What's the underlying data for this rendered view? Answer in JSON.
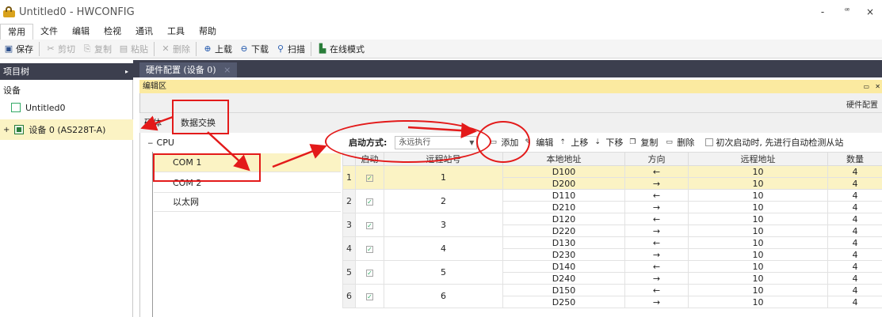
{
  "window": {
    "title": "Untitled0 - HWCONFIG",
    "minimize": "-",
    "restore": "ꟹ",
    "close": "×"
  },
  "menu": [
    "常用",
    "文件",
    "编辑",
    "检视",
    "通讯",
    "工具",
    "帮助"
  ],
  "toolbar": {
    "save": "保存",
    "cut": "剪切",
    "copy": "复制",
    "paste": "粘贴",
    "delete": "删除",
    "upload": "上载",
    "download": "下载",
    "scan": "扫描",
    "online": "在线模式"
  },
  "project_tree": {
    "header": "项目树",
    "pin": "▸",
    "section": "设备",
    "root": "Untitled0",
    "device": "设备 0 (AS228T-A)",
    "expander": "+"
  },
  "doc_tab": {
    "label": "硬件配置 (设备 0)",
    "close": "×"
  },
  "editor": {
    "title": "编辑区",
    "hw_config": "硬件配置"
  },
  "sub_tabs": {
    "tab1": "硬体",
    "tab2": "数据交换"
  },
  "cpu_tree": {
    "title": "CPU",
    "items": [
      "COM 1",
      "COM 2",
      "以太网"
    ]
  },
  "exchange": {
    "start_label": "启动方式:",
    "mode": "永远执行",
    "add": "添加",
    "edit": "编辑",
    "up": "上移",
    "down": "下移",
    "copy": "复制",
    "delete": "删除",
    "auto_detect": "初次启动时, 先进行自动检测从站"
  },
  "table": {
    "headers": [
      "",
      "启动",
      "远程站号",
      "本地地址",
      "方向",
      "远程地址",
      "数量"
    ],
    "rows": [
      {
        "no": "1",
        "station": "1",
        "lines": [
          {
            "local": "D100",
            "dir": "←",
            "remote": "10",
            "qty": "4"
          },
          {
            "local": "D200",
            "dir": "→",
            "remote": "10",
            "qty": "4"
          }
        ]
      },
      {
        "no": "2",
        "station": "2",
        "lines": [
          {
            "local": "D110",
            "dir": "←",
            "remote": "10",
            "qty": "4"
          },
          {
            "local": "D210",
            "dir": "→",
            "remote": "10",
            "qty": "4"
          }
        ]
      },
      {
        "no": "3",
        "station": "3",
        "lines": [
          {
            "local": "D120",
            "dir": "←",
            "remote": "10",
            "qty": "4"
          },
          {
            "local": "D220",
            "dir": "→",
            "remote": "10",
            "qty": "4"
          }
        ]
      },
      {
        "no": "4",
        "station": "4",
        "lines": [
          {
            "local": "D130",
            "dir": "←",
            "remote": "10",
            "qty": "4"
          },
          {
            "local": "D230",
            "dir": "→",
            "remote": "10",
            "qty": "4"
          }
        ]
      },
      {
        "no": "5",
        "station": "5",
        "lines": [
          {
            "local": "D140",
            "dir": "←",
            "remote": "10",
            "qty": "4"
          },
          {
            "local": "D240",
            "dir": "→",
            "remote": "10",
            "qty": "4"
          }
        ]
      },
      {
        "no": "6",
        "station": "6",
        "lines": [
          {
            "local": "D150",
            "dir": "←",
            "remote": "10",
            "qty": "4"
          },
          {
            "local": "D250",
            "dir": "→",
            "remote": "10",
            "qty": "4"
          }
        ]
      }
    ]
  },
  "colors": {
    "accent_yellow": "#fbf3c4",
    "annotation_red": "#e31a1a",
    "dark_panel": "#3c3f4e"
  }
}
